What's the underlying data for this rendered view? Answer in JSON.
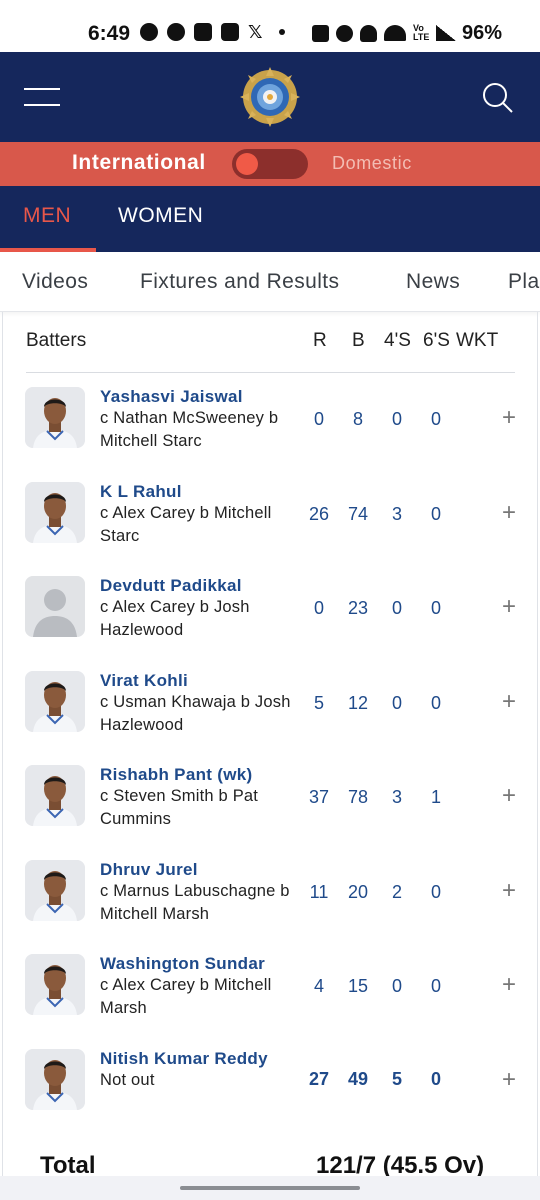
{
  "status_bar": {
    "time": "6:49",
    "battery": "96%",
    "volte": "Vo LTE"
  },
  "header": {
    "menu_icon": "hamburger-menu-icon",
    "logo": "bcci-crest-logo",
    "search_icon": "search-icon",
    "colors": {
      "header_bg": "#15275c",
      "toggle_bg": "#d8584b",
      "accent": "#e8574a",
      "name_blue": "#1f4a8a"
    }
  },
  "toggle": {
    "international": "International",
    "domestic": "Domestic"
  },
  "gender_tabs": {
    "men": "MEN",
    "women": "WOMEN",
    "selected": "MEN"
  },
  "nav": {
    "items": [
      "Videos",
      "Fixtures and Results",
      "News",
      "Pla"
    ]
  },
  "scorecard": {
    "headers": {
      "batters": "Batters",
      "runs": "R",
      "balls": "B",
      "fours": "4'S",
      "sixes": "6'S",
      "wkt": "WKT"
    },
    "batters": [
      {
        "name": "Yashasvi Jaiswal",
        "dismissal": "c Nathan McSweeney b Mitchell Starc",
        "r": "0",
        "b": "8",
        "fours": "0",
        "sixes": "0",
        "photo": true
      },
      {
        "name": "K L Rahul",
        "dismissal": "c Alex Carey b Mitchell Starc",
        "r": "26",
        "b": "74",
        "fours": "3",
        "sixes": "0",
        "photo": true
      },
      {
        "name": "Devdutt Padikkal",
        "dismissal": "c Alex Carey b Josh Hazlewood",
        "r": "0",
        "b": "23",
        "fours": "0",
        "sixes": "0",
        "photo": false
      },
      {
        "name": "Virat Kohli",
        "dismissal": "c Usman Khawaja b Josh Hazlewood",
        "r": "5",
        "b": "12",
        "fours": "0",
        "sixes": "0",
        "photo": true
      },
      {
        "name": "Rishabh Pant (wk)",
        "dismissal": "c Steven Smith b Pat Cummins",
        "r": "37",
        "b": "78",
        "fours": "3",
        "sixes": "1",
        "photo": true
      },
      {
        "name": "Dhruv Jurel",
        "dismissal": "c Marnus Labuschagne b Mitchell Marsh",
        "r": "11",
        "b": "20",
        "fours": "2",
        "sixes": "0",
        "photo": true
      },
      {
        "name": "Washington Sundar",
        "dismissal": "c Alex Carey b Mitchell Marsh",
        "r": "4",
        "b": "15",
        "fours": "0",
        "sixes": "0",
        "photo": true
      },
      {
        "name": "Nitish Kumar Reddy",
        "dismissal": "Not out",
        "r": "27",
        "b": "49",
        "fours": "5",
        "sixes": "0",
        "photo": true,
        "not_out": true
      }
    ],
    "expand_symbol": "+",
    "total_label": "Total",
    "total_value": "121/7 (45.5 Ov)"
  }
}
